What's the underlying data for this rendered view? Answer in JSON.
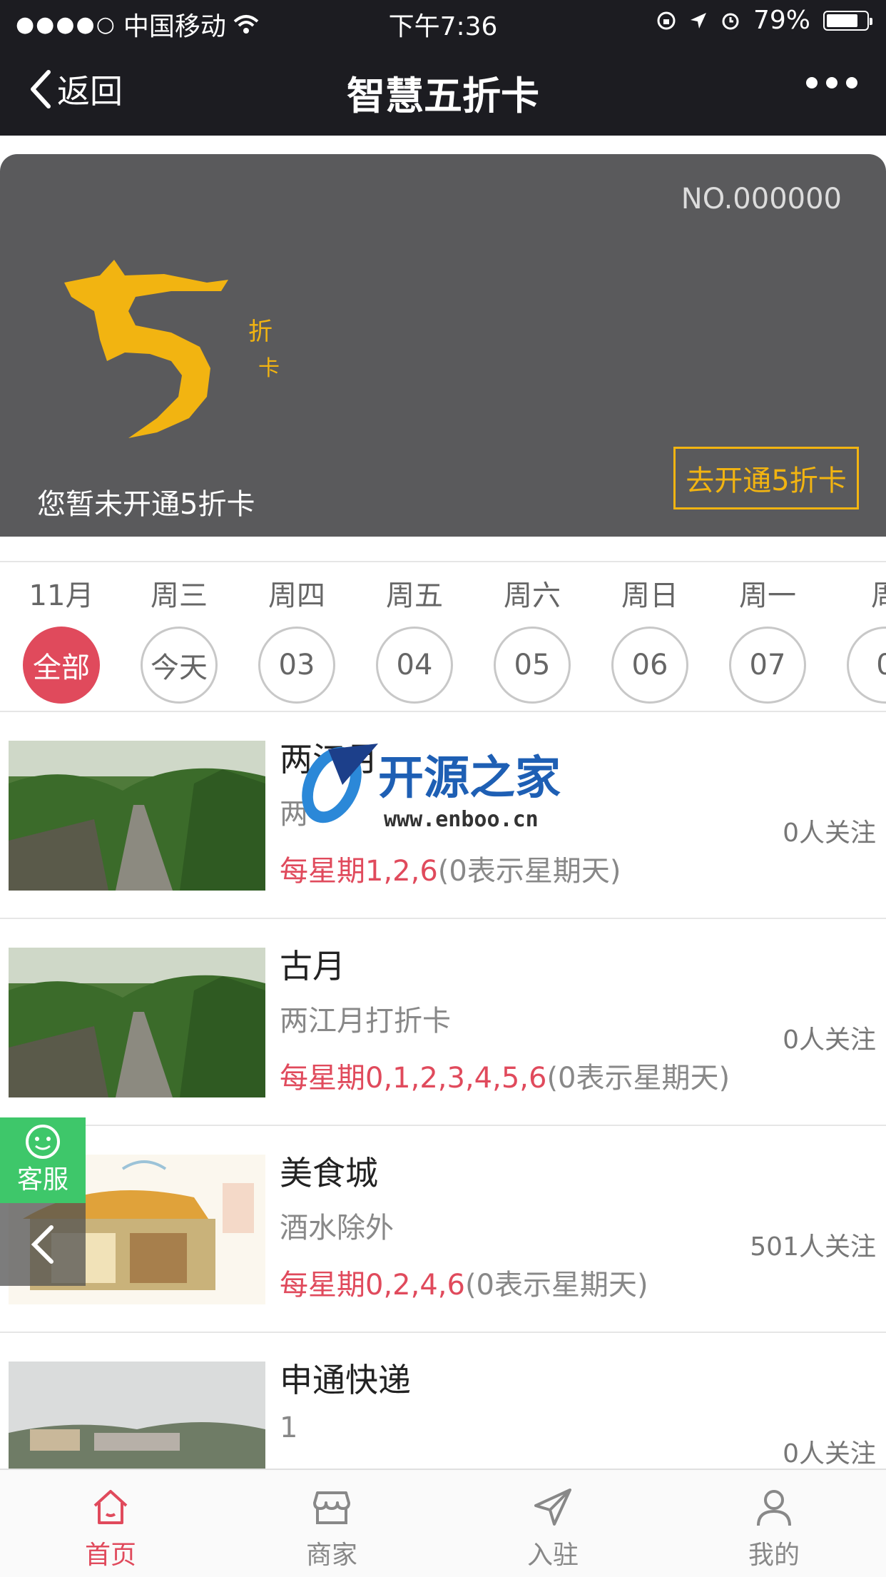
{
  "status_bar": {
    "carrier": "中国移动",
    "time": "下午7:36",
    "battery": "79%",
    "battery_level": 0.79
  },
  "nav": {
    "back_label": "返回",
    "title": "智慧五折卡"
  },
  "card": {
    "number": "NO.000000",
    "logo_text": "折卡",
    "status": "您暂未开通5折卡",
    "activate_label": "去开通5折卡",
    "accent_color": "#f2b411"
  },
  "days": [
    {
      "label": "11月",
      "value": "全部"
    },
    {
      "label": "周三",
      "value": "今天"
    },
    {
      "label": "周四",
      "value": "03"
    },
    {
      "label": "周五",
      "value": "04"
    },
    {
      "label": "周六",
      "value": "05"
    },
    {
      "label": "周日",
      "value": "06"
    },
    {
      "label": "周一",
      "value": "07"
    },
    {
      "label": "周",
      "value": "0"
    }
  ],
  "items": [
    {
      "title": "两江月",
      "subtitle": "两",
      "days_prefix": "每星期",
      "days": "1,2,6",
      "days_note": "(0表示星期天)",
      "followers": "0人关注"
    },
    {
      "title": "古月",
      "subtitle": "两江月打折卡",
      "days_prefix": "每星期",
      "days": "0,1,2,3,4,5,6",
      "days_note": "(0表示星期天)",
      "followers": "0人关注"
    },
    {
      "title": "美食城",
      "subtitle": "酒水除外",
      "days_prefix": "每星期",
      "days": "0,2,4,6",
      "days_note": "(0表示星期天)",
      "followers": "501人关注"
    },
    {
      "title": "申通快递",
      "subtitle": "1",
      "days_prefix": "",
      "days": "",
      "days_note": "",
      "followers": "0人关注"
    }
  ],
  "watermark": {
    "name": "开源之家",
    "url": "www.enboo.cn"
  },
  "customer_service": {
    "label": "客服"
  },
  "tabs": [
    {
      "label": "首页",
      "icon": "home-icon"
    },
    {
      "label": "商家",
      "icon": "shop-icon"
    },
    {
      "label": "入驻",
      "icon": "paper-plane-icon"
    },
    {
      "label": "我的",
      "icon": "user-icon"
    }
  ],
  "colors": {
    "accent": "#e04a5c",
    "card": "#5a5a5c",
    "nav": "#1c1c21",
    "service": "#3ec76a"
  }
}
